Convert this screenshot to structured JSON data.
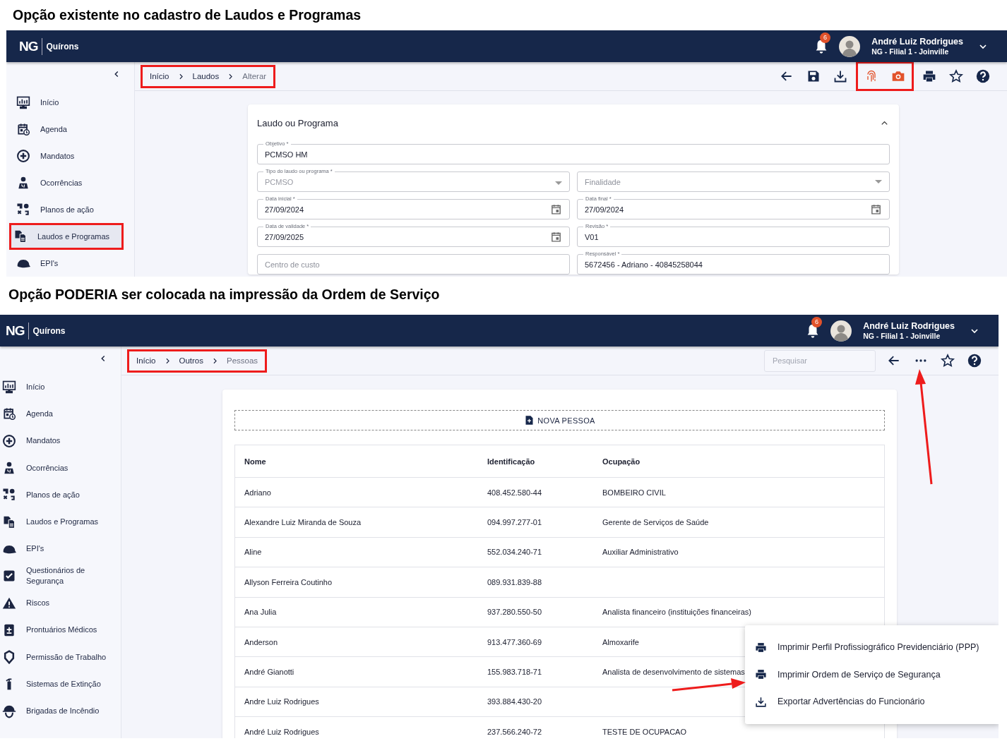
{
  "top_caption": "Opção existente no cadastro de Laudos e Programas",
  "form_screen": {
    "header": {
      "logo_mark": "NG",
      "logo_text": "Quírons",
      "notifications": "6",
      "user_name": "André Luiz Rodrigues",
      "user_branch": "NG - Filial 1 - Joinville"
    },
    "sidebar": {
      "items": [
        {
          "kind": "dashboard",
          "label": "Início",
          "selected": false,
          "highlighted": false
        },
        {
          "kind": "calendar",
          "label": "Agenda",
          "selected": false,
          "highlighted": false
        },
        {
          "kind": "plus",
          "label": "Mandatos",
          "selected": false,
          "highlighted": false
        },
        {
          "kind": "worker",
          "label": "Ocorrências",
          "selected": false,
          "highlighted": false
        },
        {
          "kind": "actions",
          "label": "Planos de ação",
          "selected": false,
          "highlighted": false
        },
        {
          "kind": "documents",
          "label": "Laudos e Programas",
          "selected": true,
          "highlighted": true
        },
        {
          "kind": "helmet",
          "label": "EPI's",
          "selected": false,
          "highlighted": false
        }
      ]
    },
    "breadcrumb": {
      "highlighted": true,
      "items": [
        "Início",
        "Laudos",
        "Alterar"
      ]
    },
    "toolbar_groups": [
      {
        "highlighted": false,
        "icons": [
          {
            "kind": "back"
          },
          {
            "kind": "save"
          },
          {
            "kind": "download"
          }
        ]
      },
      {
        "highlighted": true,
        "icons": [
          {
            "kind": "fingerprint"
          },
          {
            "kind": "camera"
          }
        ]
      },
      {
        "highlighted": false,
        "icons": [
          {
            "kind": "print"
          },
          {
            "kind": "star"
          },
          {
            "kind": "help"
          }
        ]
      }
    ],
    "card": {
      "title": "Laudo ou Programa",
      "expanded": true,
      "rows": [
        [
          {
            "kind": "text",
            "label": "Objetivo *",
            "value": "PCMSO HM",
            "disabled": false
          }
        ],
        [
          {
            "kind": "select",
            "label": "Tipo do laudo ou programa *",
            "value": "PCMSO",
            "disabled": true
          },
          {
            "kind": "select",
            "placeholder": "Finalidade",
            "disabled": false
          }
        ],
        [
          {
            "kind": "date",
            "label": "Data inicial *",
            "value": "27/09/2024",
            "disabled": false
          },
          {
            "kind": "date",
            "label": "Data final *",
            "value": "27/09/2024",
            "disabled": false
          }
        ],
        [
          {
            "kind": "date",
            "label": "Data de validade *",
            "value": "27/09/2025",
            "disabled": false
          },
          {
            "kind": "text",
            "label": "Revisão *",
            "value": "V01",
            "disabled": false
          }
        ],
        [
          {
            "kind": "text",
            "placeholder": "Centro de custo",
            "disabled": false
          },
          {
            "kind": "text",
            "label": "Responsável *",
            "value": "5672456 - Adriano - 40845258044",
            "disabled": false
          }
        ]
      ]
    }
  },
  "bottom_caption": "Opção PODERIA ser colocada na impressão da Ordem de Serviço",
  "list_screen": {
    "header": {
      "logo_mark": "NG",
      "logo_text": "Quírons",
      "notifications": "6",
      "user_name": "André Luiz Rodrigues",
      "user_branch": "NG - Filial 1 - Joinville"
    },
    "sidebar": {
      "items": [
        {
          "kind": "dashboard",
          "label": "Início",
          "selected": false,
          "highlighted": false
        },
        {
          "kind": "calendar",
          "label": "Agenda",
          "selected": false,
          "highlighted": false
        },
        {
          "kind": "plus",
          "label": "Mandatos",
          "selected": false,
          "highlighted": false
        },
        {
          "kind": "worker",
          "label": "Ocorrências",
          "selected": false,
          "highlighted": false
        },
        {
          "kind": "actions",
          "label": "Planos de ação",
          "selected": false,
          "highlighted": false
        },
        {
          "kind": "documents",
          "label": "Laudos e Programas",
          "selected": false,
          "highlighted": false
        },
        {
          "kind": "helmet",
          "label": "EPI's",
          "selected": false,
          "highlighted": false
        },
        {
          "kind": "checklist",
          "label": "Questionários de Segurança",
          "selected": false,
          "highlighted": false
        },
        {
          "kind": "warning",
          "label": "Riscos",
          "selected": false,
          "highlighted": false
        },
        {
          "kind": "clipboard",
          "label": "Prontuários Médicos",
          "selected": false,
          "highlighted": false
        },
        {
          "kind": "permit",
          "label": "Permissão de Trabalho",
          "selected": false,
          "highlighted": false
        },
        {
          "kind": "extinguisher",
          "label": "Sistemas de Extinção",
          "selected": false,
          "highlighted": false
        },
        {
          "kind": "brigade",
          "label": "Brigadas de Incêndio",
          "selected": false,
          "highlighted": false
        }
      ]
    },
    "breadcrumb": {
      "highlighted": true,
      "items": [
        "Início",
        "Outros",
        "Pessoas"
      ]
    },
    "search": {
      "placeholder": "Pesquisar"
    },
    "toolbar_groups": [
      {
        "highlighted": false,
        "icons": [
          {
            "kind": "back"
          },
          {
            "kind": "more"
          },
          {
            "kind": "star"
          },
          {
            "kind": "help"
          }
        ]
      }
    ],
    "new_button": "NOVA PESSOA",
    "table": {
      "columns": [
        "Nome",
        "Identificação",
        "Ocupação"
      ],
      "rows": [
        [
          "Adriano",
          "408.452.580-44",
          "BOMBEIRO CIVIL"
        ],
        [
          "Alexandre Luiz Miranda de Souza",
          "094.997.277-01",
          "Gerente de Serviços de Saúde"
        ],
        [
          "Aline",
          "552.034.240-71",
          "Auxiliar Administrativo"
        ],
        [
          "Allyson Ferreira Coutinho",
          "089.931.839-88",
          ""
        ],
        [
          "Ana Julia",
          "937.280.550-50",
          "Analista financeiro (instituições financeiras)"
        ],
        [
          "Anderson",
          "913.477.360-69",
          "Almoxarife"
        ],
        [
          "André Gianotti",
          "155.983.718-71",
          "Analista de desenvolvimento de sistemas"
        ],
        [
          "Andre Luiz Rodrigues",
          "393.884.430-20",
          ""
        ],
        [
          "André Luiz Rodrigues",
          "237.566.240-72",
          "TESTE DE OCUPACAO"
        ]
      ]
    },
    "menu": {
      "items": [
        {
          "kind": "print",
          "label": "Imprimir Perfil Profissiográfico Previdenciário (PPP)"
        },
        {
          "kind": "print",
          "label": "Imprimir Ordem de Serviço de Segurança"
        },
        {
          "kind": "download",
          "label": "Exportar Advertências do Funcionário"
        }
      ]
    }
  }
}
